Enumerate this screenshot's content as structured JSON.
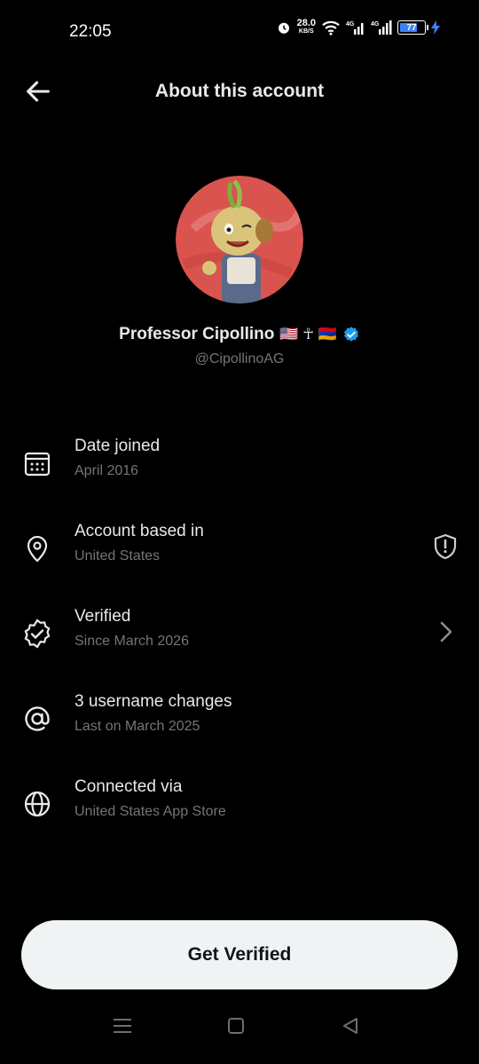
{
  "status_bar": {
    "time": "22:05",
    "speed_value": "28.0",
    "speed_unit": "KB/S",
    "network_1": "4G",
    "network_2": "4G",
    "battery": "77",
    "battery_fill_percent": 77,
    "battery_color": "#3b82f6"
  },
  "header": {
    "title": "About this account"
  },
  "profile": {
    "name": "Professor Cipollino",
    "emojis": "🇺🇸 ☥ 🇦🇲",
    "handle": "@CipollinoAG",
    "verified_color": "#1d9bf0"
  },
  "rows": [
    {
      "icon": "calendar-icon",
      "label": "Date joined",
      "sub": "April 2016"
    },
    {
      "icon": "location-pin-icon",
      "label": "Account based in",
      "sub": "United States",
      "right_icon": "shield-alert-icon"
    },
    {
      "icon": "verified-badge-icon",
      "label": "Verified",
      "sub": "Since March 2026",
      "right_icon": "chevron-right-icon"
    },
    {
      "icon": "at-sign-icon",
      "label": "3 username changes",
      "sub": "Last on March 2025"
    },
    {
      "icon": "globe-icon",
      "label": "Connected via",
      "sub": "United States App Store"
    }
  ],
  "cta": {
    "label": "Get Verified"
  },
  "colors": {
    "background": "#000000",
    "primary_text": "#e7e9ea",
    "secondary_text": "#71767b",
    "button_bg": "#eff3f4"
  }
}
